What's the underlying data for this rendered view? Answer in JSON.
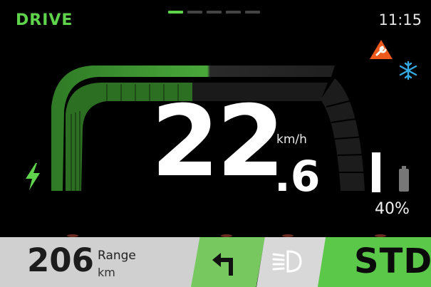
{
  "status": {
    "mode": "DRIVE",
    "time": "11:15",
    "page_indicator": {
      "pages": 5,
      "active": 1
    }
  },
  "indicators": {
    "service_icon": "wrench-warning-icon",
    "frost_icon": "snowflake-icon"
  },
  "speed": {
    "whole": "22",
    "decimal": ".6",
    "unit": "km/h"
  },
  "battery": {
    "percent_text": "40%",
    "level": 0.4,
    "charging_icon": "lightning-bolt-icon"
  },
  "bottom_bar": {
    "range_value": "206",
    "range_label": "Range",
    "range_unit": "km",
    "turn_icon": "turn-left-arrow-icon",
    "headlight_icon": "low-beam-icon",
    "riding_mode": "STD"
  },
  "colors": {
    "accent_green": "#5fd34c",
    "gauge_green": "#3f9a2f",
    "warning_orange": "#ee5a1e",
    "frost_blue": "#34a9e3",
    "panel_gray": "#cfd0cf"
  }
}
